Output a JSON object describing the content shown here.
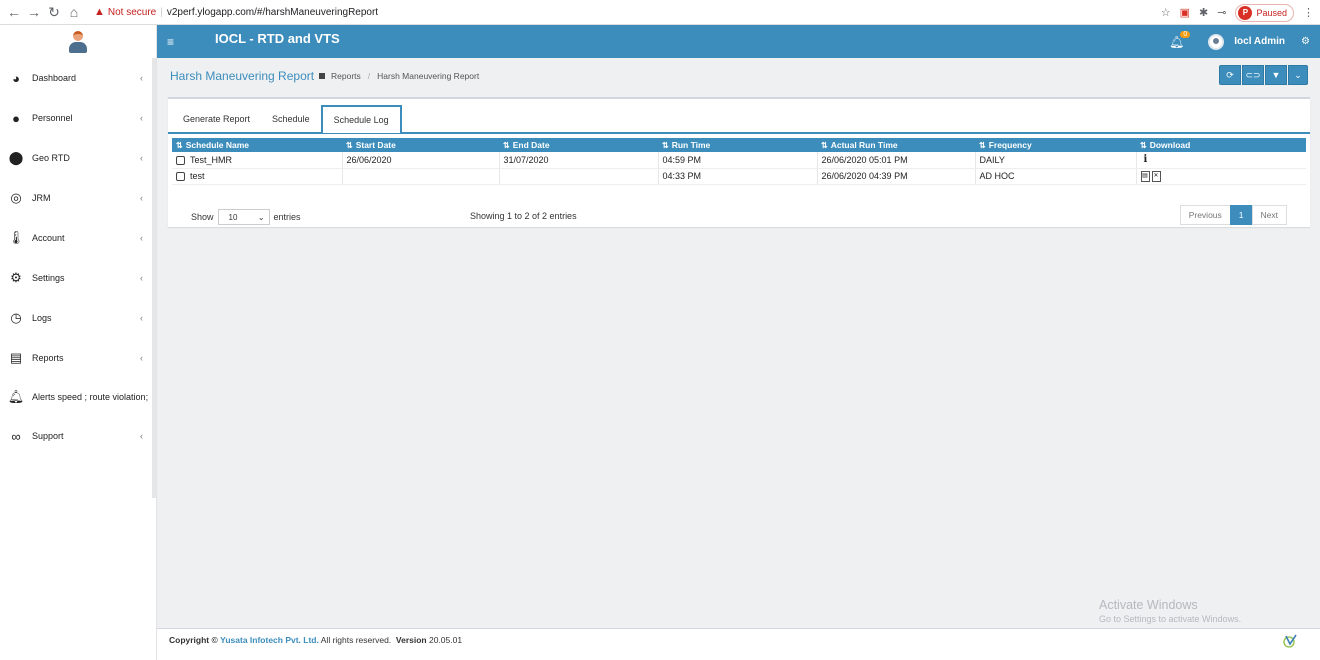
{
  "browser": {
    "security_label": "Not secure",
    "url": "v2perf.ylogapp.com/#/harshManeuveringReport",
    "paused_label": "Paused",
    "profile_initial": "P"
  },
  "sidebar": {
    "items": [
      {
        "label": "Dashboard",
        "icon": "pie-chart-icon"
      },
      {
        "label": "Personnel",
        "icon": "users-icon"
      },
      {
        "label": "Geo RTD",
        "icon": "map-marker-icon"
      },
      {
        "label": "JRM",
        "icon": "life-ring-icon"
      },
      {
        "label": "Account",
        "icon": "thermometer-icon"
      },
      {
        "label": "Settings",
        "icon": "gear-icon"
      },
      {
        "label": "Logs",
        "icon": "clock-icon"
      },
      {
        "label": "Reports",
        "icon": "list-icon"
      },
      {
        "label": "Alerts speed ; route violation;",
        "icon": "bell-icon"
      },
      {
        "label": "Support",
        "icon": "support-icon"
      }
    ]
  },
  "header": {
    "app_title": "IOCL - RTD and VTS",
    "notification_count": "0",
    "user_name": "Iocl Admin"
  },
  "page": {
    "title": "Harsh Maneuvering Report",
    "breadcrumb": [
      "Reports",
      "Harsh Maneuvering Report"
    ]
  },
  "tabs": [
    "Generate Report",
    "Schedule",
    "Schedule Log"
  ],
  "table": {
    "columns": [
      "Schedule Name",
      "Start Date",
      "End Date",
      "Run Time",
      "Actual Run Time",
      "Frequency",
      "Download"
    ],
    "rows": [
      {
        "name": "Test_HMR",
        "start": "26/06/2020",
        "end": "31/07/2020",
        "run": "04:59 PM",
        "actual": "26/06/2020 05:01 PM",
        "freq": "DAILY"
      },
      {
        "name": "test",
        "start": "",
        "end": "",
        "run": "04:33 PM",
        "actual": "26/06/2020 04:39 PM",
        "freq": "AD HOC"
      }
    ]
  },
  "table_footer": {
    "show_label": "Show",
    "length_value": "10",
    "entries_label": "entries",
    "info": "Showing 1 to 2 of 2 entries",
    "prev": "Previous",
    "page": "1",
    "next": "Next"
  },
  "footer": {
    "copyright_prefix": "Copyright ©",
    "company": "Yusata Infotech Pvt. Ltd.",
    "rights": "All rights reserved.",
    "version_label": "Version",
    "version": "20.05.01"
  },
  "watermark": {
    "title": "Activate Windows",
    "subtitle": "Go to Settings to activate Windows."
  }
}
